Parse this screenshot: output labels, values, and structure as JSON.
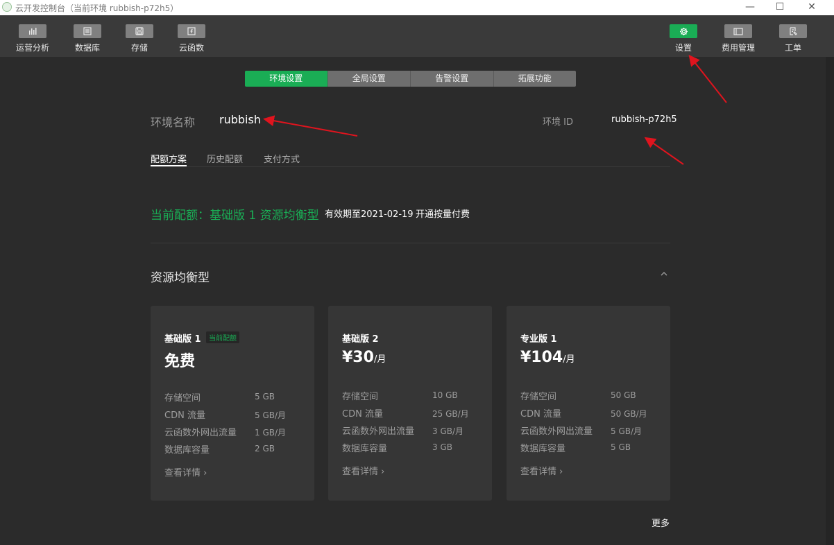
{
  "titlebar": {
    "title": "云开发控制台（当前环境 rubbish-p72h5）",
    "minimize": "—",
    "maximize": "☐",
    "close": "✕"
  },
  "toolbar": {
    "left": [
      {
        "label": "运营分析",
        "icon": "chart-bars-icon"
      },
      {
        "label": "数据库",
        "icon": "database-icon"
      },
      {
        "label": "存储",
        "icon": "storage-icon"
      },
      {
        "label": "云函数",
        "icon": "function-icon"
      }
    ],
    "right": [
      {
        "label": "设置",
        "icon": "gear-icon",
        "active": true
      },
      {
        "label": "费用管理",
        "icon": "billing-icon"
      },
      {
        "label": "工单",
        "icon": "ticket-icon"
      }
    ],
    "accent": "#1aad55"
  },
  "seg_tabs": [
    {
      "label": "环境设置",
      "active": true
    },
    {
      "label": "全局设置"
    },
    {
      "label": "告警设置"
    },
    {
      "label": "拓展功能"
    }
  ],
  "env": {
    "name_label": "环境名称",
    "name_value": "rubbish",
    "id_label": "环境 ID",
    "id_value": "rubbish-p72h5"
  },
  "sub_tabs": [
    {
      "label": "配额方案",
      "active": true
    },
    {
      "label": "历史配额"
    },
    {
      "label": "支付方式"
    }
  ],
  "quota": {
    "current": "当前配额：基础版 1 资源均衡型",
    "expire": "有效期至2021-02-19",
    "payg": "开通按量付费"
  },
  "section_title": "资源均衡型",
  "cards": [
    {
      "name": "基础版 1",
      "badge": "当前配额",
      "price": "免费",
      "unit": "",
      "rows": [
        {
          "label": "存储空间",
          "value": "5 GB"
        },
        {
          "label": "CDN 流量",
          "value": "5 GB/月"
        },
        {
          "label": "云函数外网出流量",
          "value": "1 GB/月"
        },
        {
          "label": "数据库容量",
          "value": "2 GB"
        }
      ],
      "detail": "查看详情"
    },
    {
      "name": "基础版 2",
      "price": "¥30",
      "unit": "/月",
      "rows": [
        {
          "label": "存储空间",
          "value": "10 GB"
        },
        {
          "label": "CDN 流量",
          "value": "25 GB/月"
        },
        {
          "label": "云函数外网出流量",
          "value": "3 GB/月"
        },
        {
          "label": "数据库容量",
          "value": "3 GB"
        }
      ],
      "detail": "查看详情"
    },
    {
      "name": "专业版 1",
      "price": "¥104",
      "unit": "/月",
      "rows": [
        {
          "label": "存储空间",
          "value": "50 GB"
        },
        {
          "label": "CDN 流量",
          "value": "50 GB/月"
        },
        {
          "label": "云函数外网出流量",
          "value": "5 GB/月"
        },
        {
          "label": "数据库容量",
          "value": "5 GB"
        }
      ],
      "detail": "查看详情"
    }
  ],
  "more": "更多",
  "annotation_color": "#e0141e"
}
